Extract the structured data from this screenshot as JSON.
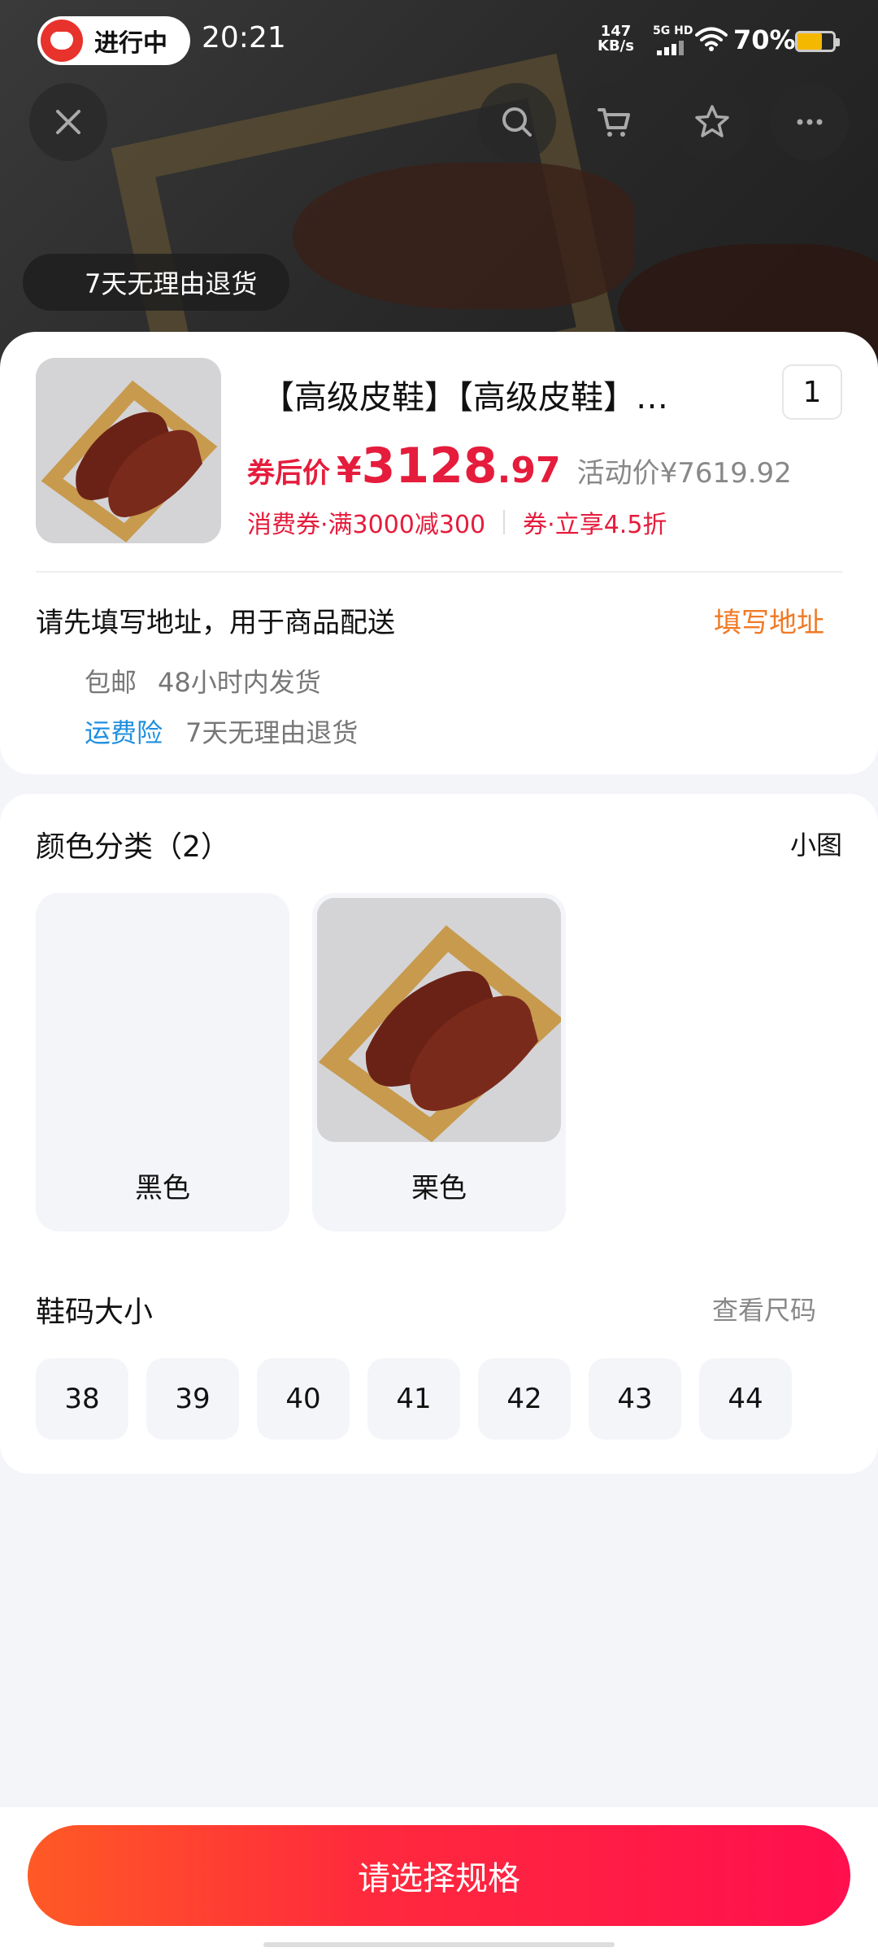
{
  "status_bar": {
    "live_label": "进行中",
    "time": "20:21",
    "net_speed": "147",
    "net_unit": "KB/s",
    "signal_label": "5G HD",
    "battery": "70%"
  },
  "overlay": {
    "return_badge": "7天无理由退货"
  },
  "product": {
    "title": "【高级皮鞋】【高级皮鞋】…",
    "quantity": "1",
    "after_coupon_label": "券后价",
    "currency": "¥",
    "price_int": "3128",
    "price_dec": ".97",
    "activity_price": "活动价¥7619.92",
    "coupon_1": "消费券·满3000减300",
    "coupon_2": "券·立享4.5折"
  },
  "address": {
    "prompt": "请先填写地址，用于商品配送",
    "action": "填写地址",
    "free_shipping": "包邮",
    "ship_time": "48小时内发货",
    "insurance": "运费险",
    "return_policy": "7天无理由退货"
  },
  "color_section": {
    "title": "颜色分类（2）",
    "view_toggle": "小图",
    "options": [
      {
        "label": "黑色"
      },
      {
        "label": "栗色"
      }
    ]
  },
  "size_section": {
    "title": "鞋码大小",
    "size_chart": "查看尺码",
    "sizes": [
      "38",
      "39",
      "40",
      "41",
      "42",
      "43",
      "44"
    ]
  },
  "cta": {
    "label": "请选择规格"
  },
  "colors": {
    "accent_red": "#e51c3c",
    "link_orange": "#f07a26",
    "link_blue": "#1f8fe0"
  }
}
